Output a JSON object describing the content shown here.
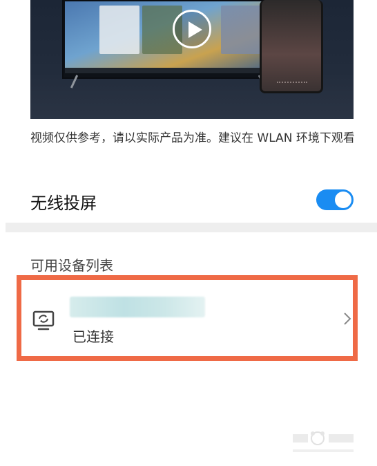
{
  "video": {
    "play_icon": "play-icon"
  },
  "caption": "视频仅供参考，请以实际产品为准。建议在 WLAN 环境下观看",
  "wireless_projection": {
    "label": "无线投屏",
    "enabled": true,
    "accent": "#1a8cf2"
  },
  "available_devices": {
    "title": "可用设备列表",
    "items": [
      {
        "name": "",
        "status": "已连接",
        "icon": "cast-screen-icon"
      }
    ]
  },
  "highlight_color": "#ef6a46"
}
